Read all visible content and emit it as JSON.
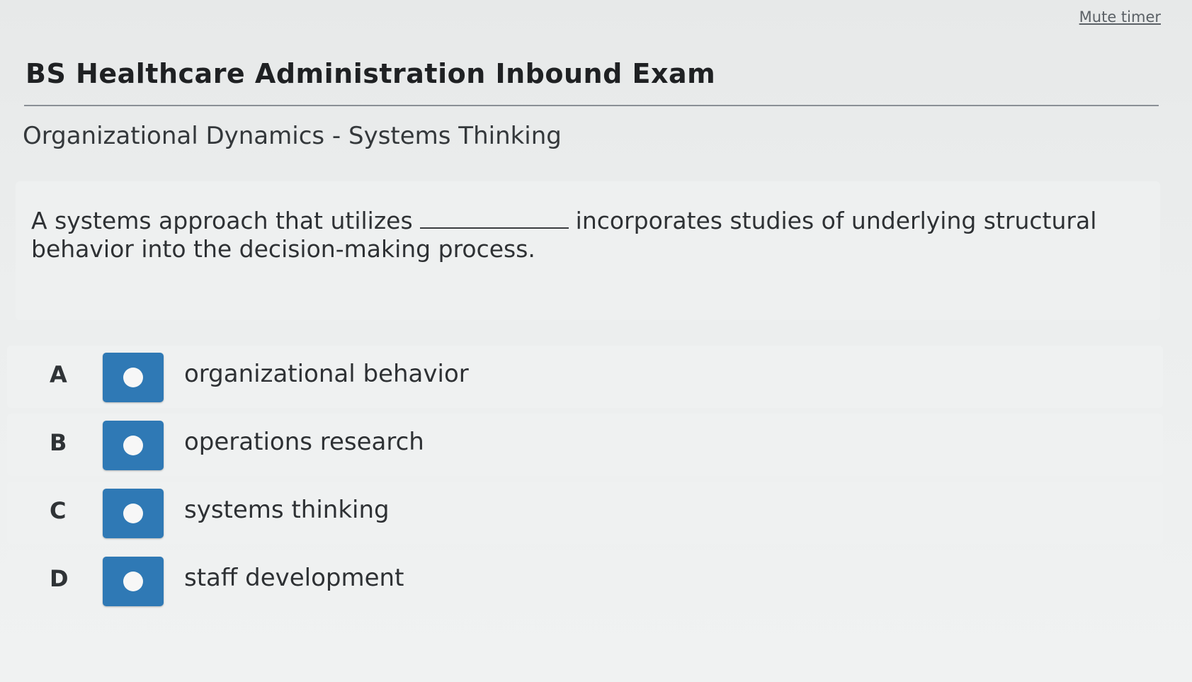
{
  "header": {
    "mute_timer": "Mute timer",
    "title": "BS Healthcare Administration Inbound Exam"
  },
  "section": {
    "title": "Organizational Dynamics - Systems Thinking"
  },
  "question": {
    "text_before": "A systems approach that utilizes",
    "text_after": "incorporates studies of underlying structural behavior into the decision-making process."
  },
  "options": [
    {
      "letter": "A",
      "label": "organizational behavior"
    },
    {
      "letter": "B",
      "label": "operations research"
    },
    {
      "letter": "C",
      "label": "systems thinking"
    },
    {
      "letter": "D",
      "label": "staff development"
    }
  ],
  "colors": {
    "radio_box": "#2f79b5",
    "background": "#e9ebeb"
  }
}
